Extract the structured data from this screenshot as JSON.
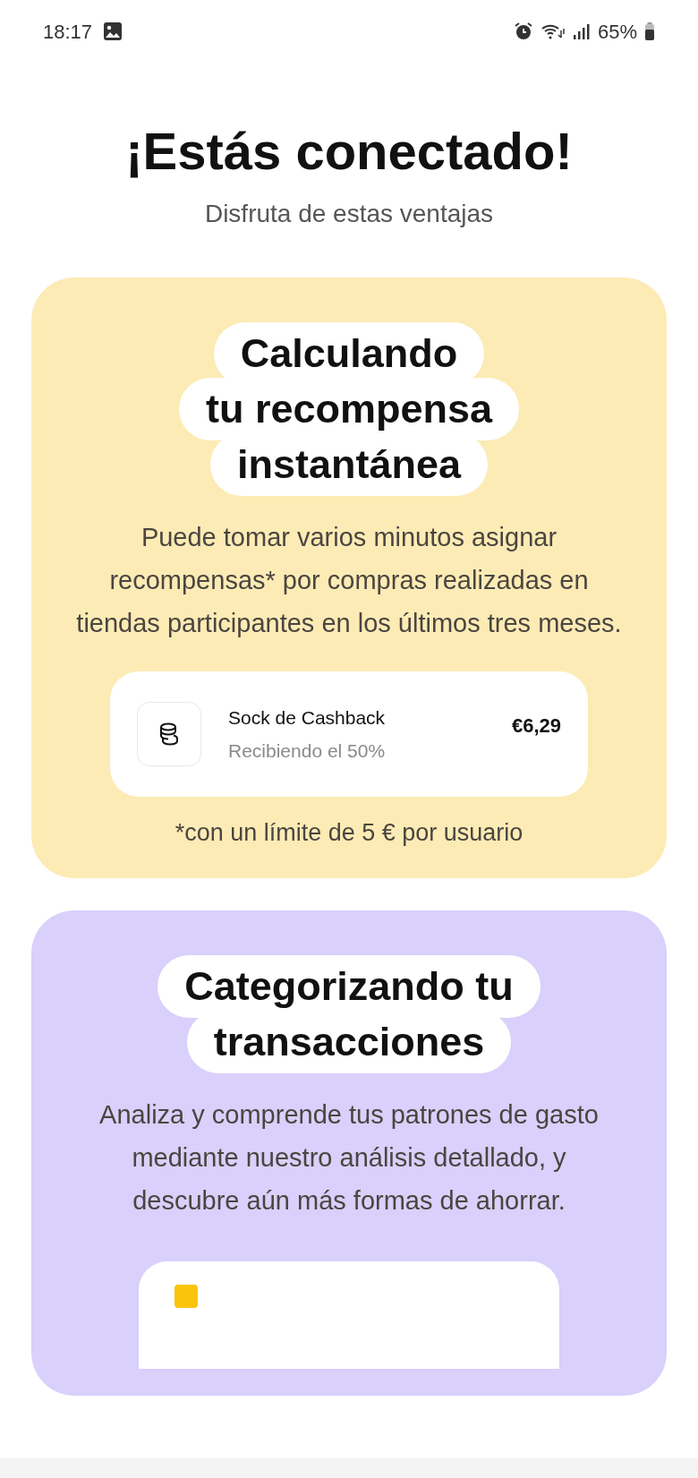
{
  "status_bar": {
    "time": "18:17",
    "battery": "65%"
  },
  "header": {
    "title": "¡Estás conectado!",
    "subtitle": "Disfruta de estas ventajas"
  },
  "cards": [
    {
      "kind": "reward",
      "title_lines": [
        "Calculando",
        "tu recompensa",
        "instantánea"
      ],
      "body": "Puede tomar varios minutos asignar recompensas* por compras realizadas en tiendas participantes en los últimos tres meses.",
      "item": {
        "name": "Sock de Cashback",
        "detail": "Recibiendo el 50%",
        "amount": "€6,29"
      },
      "footnote": "*con un límite de 5 € por usuario"
    },
    {
      "kind": "categories",
      "title_lines": [
        "Categorizando tu",
        "transacciones"
      ],
      "body": "Analiza y comprende tus patrones de gasto mediante nuestro análisis detallado, y descubre aún más formas de ahorrar."
    }
  ]
}
